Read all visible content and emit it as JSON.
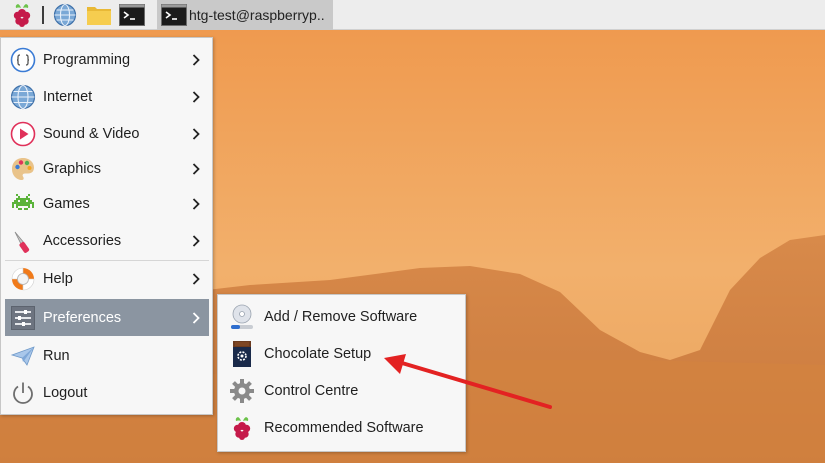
{
  "taskbar": {
    "launchers": [
      {
        "name": "raspberry-menu-icon"
      },
      {
        "name": "web-browser-icon"
      },
      {
        "name": "file-manager-icon"
      },
      {
        "name": "terminal-icon"
      }
    ],
    "task": {
      "icon": "terminal-icon",
      "label": "htg-test@raspberryp.."
    }
  },
  "main_menu": {
    "items": [
      {
        "label": "Programming",
        "icon": "programming-icon",
        "submenu": true
      },
      {
        "label": "Internet",
        "icon": "globe-icon",
        "submenu": true
      },
      {
        "label": "Sound & Video",
        "icon": "play-icon",
        "submenu": true
      },
      {
        "label": "Graphics",
        "icon": "palette-icon",
        "submenu": true
      },
      {
        "label": "Games",
        "icon": "space-invader-icon",
        "submenu": true
      },
      {
        "label": "Accessories",
        "icon": "swiss-knife-icon",
        "submenu": true
      },
      {
        "label": "Help",
        "icon": "lifebuoy-icon",
        "submenu": true
      },
      {
        "label": "Preferences",
        "icon": "preferences-sliders-icon",
        "submenu": true,
        "selected": true
      },
      {
        "label": "Run",
        "icon": "paper-plane-icon",
        "submenu": false
      },
      {
        "label": "Logout",
        "icon": "power-icon",
        "submenu": false
      }
    ]
  },
  "preferences_submenu": {
    "items": [
      {
        "label": "Add / Remove Software",
        "icon": "software-disc-icon"
      },
      {
        "label": "Chocolate Setup",
        "icon": "chocolate-setup-icon"
      },
      {
        "label": "Control Centre",
        "icon": "gear-icon"
      },
      {
        "label": "Recommended Software",
        "icon": "raspberry-icon"
      }
    ]
  },
  "colors": {
    "selection": "#8b95a1",
    "annotation_arrow": "#e32222",
    "menu_background": "#f7f7f7",
    "taskbar_background": "#ededed"
  }
}
